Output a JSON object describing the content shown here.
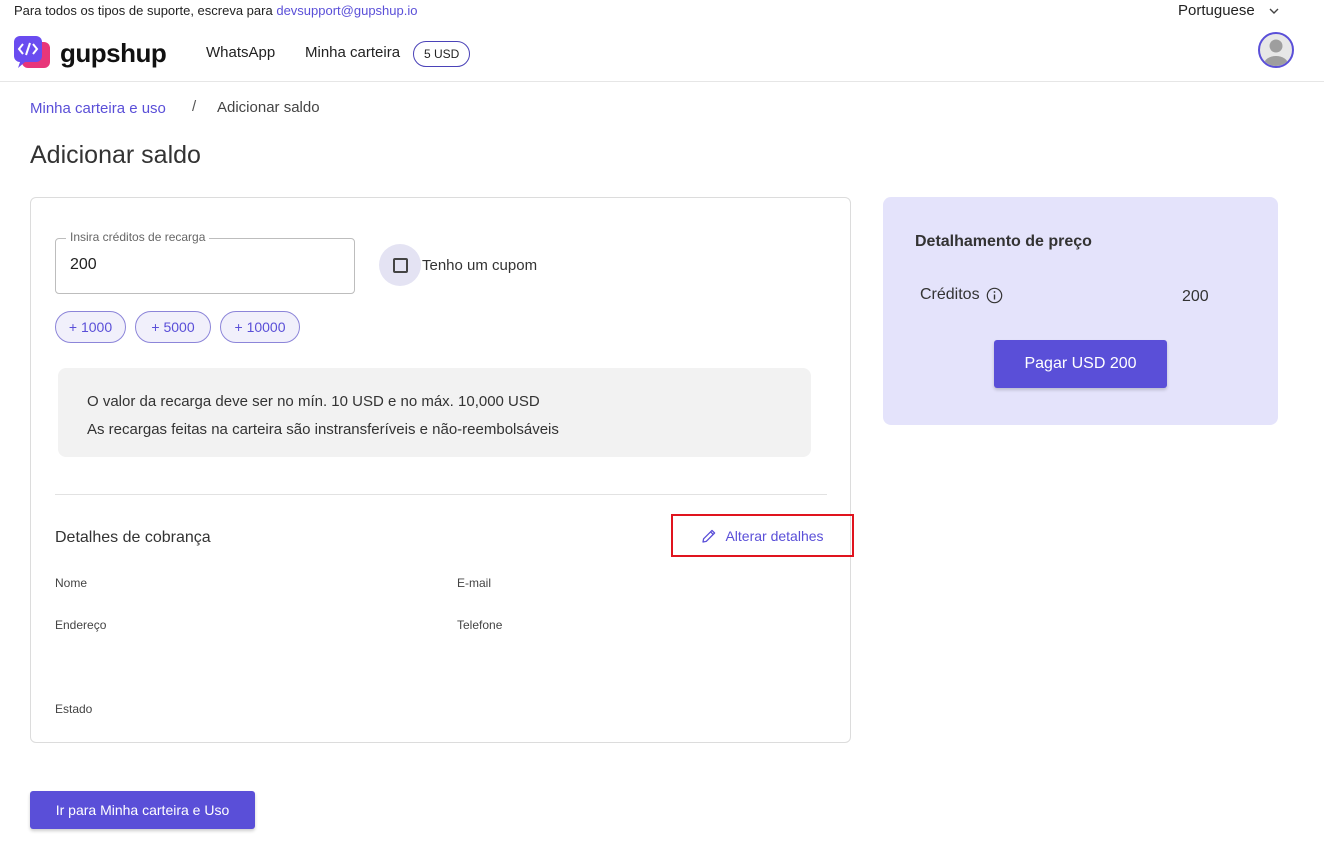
{
  "header": {
    "support_text": "Para todos os tipos de suporte, escreva para",
    "support_email": "devsupport@gupshup.io",
    "language": "Portuguese",
    "logo_text": "gupshup",
    "nav": {
      "whatsapp": "WhatsApp",
      "wallet": "Minha carteira",
      "wallet_badge": "5 USD"
    }
  },
  "breadcrumb": {
    "link": "Minha carteira e uso",
    "separator": "/",
    "current": "Adicionar saldo"
  },
  "page_title": "Adicionar saldo",
  "recharge": {
    "field_label": "Insira créditos de recarga",
    "field_value": "200",
    "coupon_label": "Tenho um cupom",
    "chips": [
      "+ 1000",
      "+ 5000",
      "+ 10000"
    ],
    "info_lines": [
      "O valor da recarga deve ser no mín. 10 USD e no máx. 10,000 USD",
      "As recargas feitas na carteira são instransferíveis e não-reembolsáveis"
    ]
  },
  "billing": {
    "title": "Detalhes de cobrança",
    "edit_label": "Alterar detalhes",
    "fields": {
      "name": "Nome",
      "email": "E-mail",
      "address": "Endereço",
      "phone": "Telefone",
      "state": "Estado"
    }
  },
  "price": {
    "title": "Detalhamento de preço",
    "credits_label": "Créditos",
    "credits_value": "200",
    "pay_button": "Pagar USD 200"
  },
  "go_button": "Ir para Minha carteira e Uso",
  "colors": {
    "accent": "#5a4fd8",
    "panel": "#e4e3fb",
    "highlight": "#e0141e"
  }
}
